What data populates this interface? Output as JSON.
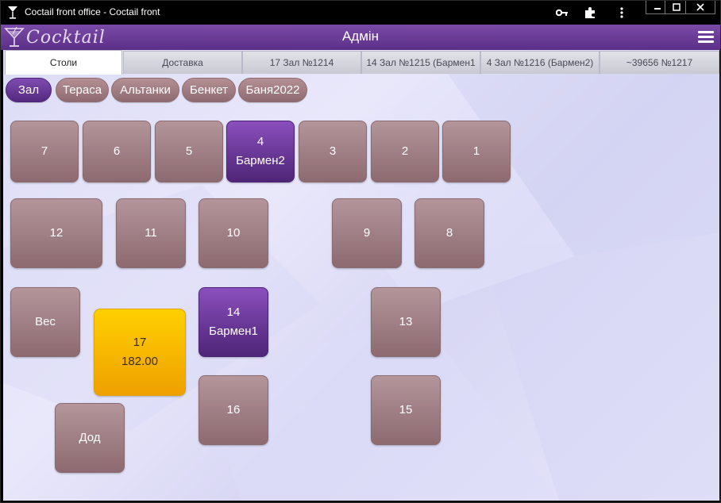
{
  "window": {
    "title": "Coctail front office - Coctail front",
    "icons": [
      "key-icon",
      "puzzle-icon",
      "more-vert-icon"
    ],
    "controls": [
      "minimize-icon",
      "maximize-icon",
      "close-icon"
    ]
  },
  "app": {
    "logo_text": "Cocktail",
    "header_title": "Адмін",
    "menu_icon": "hamburger-icon"
  },
  "tabs": [
    {
      "label": "Столи",
      "active": true
    },
    {
      "label": "Доставка",
      "active": false
    },
    {
      "label": "17 Зал №1214",
      "active": false
    },
    {
      "label": "14 Зал №1215 (Бармен1",
      "active": false
    },
    {
      "label": "4 Зал №1216 (Бармен2)",
      "active": false
    },
    {
      "label": "~39656 №1217",
      "active": false
    }
  ],
  "halls": [
    {
      "label": "Зал",
      "active": true
    },
    {
      "label": "Тераса",
      "active": false
    },
    {
      "label": "Альтанки",
      "active": false
    },
    {
      "label": "Бенкет",
      "active": false
    },
    {
      "label": "Баня2022",
      "active": false
    }
  ],
  "tables": [
    {
      "line1": "7",
      "line2": "",
      "state": "free"
    },
    {
      "line1": "6",
      "line2": "",
      "state": "free"
    },
    {
      "line1": "5",
      "line2": "",
      "state": "free"
    },
    {
      "line1": "4",
      "line2": "Бармен2",
      "state": "busy"
    },
    {
      "line1": "3",
      "line2": "",
      "state": "free"
    },
    {
      "line1": "2",
      "line2": "",
      "state": "free"
    },
    {
      "line1": "1",
      "line2": "",
      "state": "free"
    },
    {
      "line1": "12",
      "line2": "",
      "state": "free"
    },
    {
      "line1": "11",
      "line2": "",
      "state": "free"
    },
    {
      "line1": "10",
      "line2": "",
      "state": "free"
    },
    {
      "line1": "9",
      "line2": "",
      "state": "free"
    },
    {
      "line1": "8",
      "line2": "",
      "state": "free"
    },
    {
      "line1": "Вес",
      "line2": "",
      "state": "free"
    },
    {
      "line1": "17",
      "line2": "182.00",
      "state": "bill"
    },
    {
      "line1": "14",
      "line2": "Бармен1",
      "state": "busy"
    },
    {
      "line1": "13",
      "line2": "",
      "state": "free"
    },
    {
      "line1": "16",
      "line2": "",
      "state": "free"
    },
    {
      "line1": "15",
      "line2": "",
      "state": "free"
    },
    {
      "line1": "Дод",
      "line2": "",
      "state": "free"
    }
  ]
}
